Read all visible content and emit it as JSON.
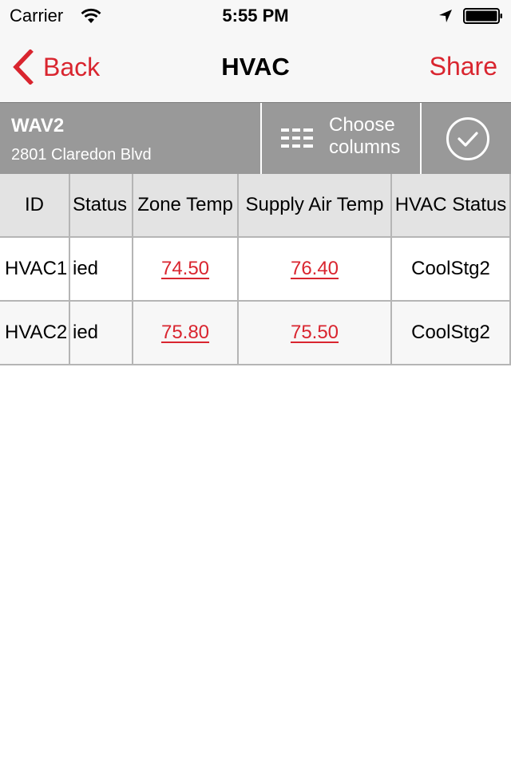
{
  "status_bar": {
    "carrier": "Carrier",
    "wifi_icon": "wifi-icon",
    "time": "5:55 PM",
    "location_icon": "location-arrow-icon",
    "battery_icon": "battery-full-icon"
  },
  "nav": {
    "back_label": "Back",
    "back_icon": "chevron-left-icon",
    "title": "HVAC",
    "share_label": "Share"
  },
  "site": {
    "name": "WAV2",
    "address": "2801 Claredon Blvd"
  },
  "toolbar": {
    "choose_columns_line1": "Choose",
    "choose_columns_line2": "columns",
    "choose_columns_icon": "columns-list-icon",
    "confirm_icon": "check-circle-icon"
  },
  "table": {
    "headers": [
      "ID",
      "Status",
      "Zone Temp",
      "Supply Air Temp",
      "HVAC Status"
    ],
    "rows": [
      {
        "id": "HVAC1",
        "status": "ied",
        "zone_temp": "74.50",
        "supply_air_temp": "76.40",
        "hvac_status": "CoolStg2"
      },
      {
        "id": "HVAC2",
        "status": "ied",
        "zone_temp": "75.80",
        "supply_air_temp": "75.50",
        "hvac_status": "CoolStg2"
      }
    ]
  },
  "colors": {
    "accent": "#d9252f",
    "info_bar": "#999999",
    "header_row": "#e3e3e3"
  }
}
